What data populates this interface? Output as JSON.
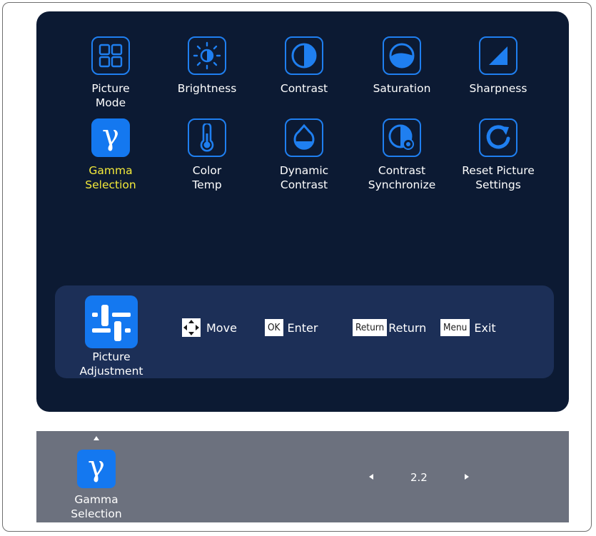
{
  "menu": {
    "items": [
      {
        "id": "picture-mode",
        "label": "Picture\nMode",
        "icon": "grid-icon",
        "active": false
      },
      {
        "id": "brightness",
        "label": "Brightness",
        "icon": "sun-icon",
        "active": false
      },
      {
        "id": "contrast",
        "label": "Contrast",
        "icon": "half-circle-icon",
        "active": false
      },
      {
        "id": "saturation",
        "label": "Saturation",
        "icon": "saturation-icon",
        "active": false
      },
      {
        "id": "sharpness",
        "label": "Sharpness",
        "icon": "triangle-icon",
        "active": false
      },
      {
        "id": "gamma-selection",
        "label": "Gamma\nSelection",
        "icon": "gamma-icon",
        "active": true
      },
      {
        "id": "color-temp",
        "label": "Color\nTemp",
        "icon": "thermometer-icon",
        "active": false
      },
      {
        "id": "dynamic-contrast",
        "label": "Dynamic\nContrast",
        "icon": "drop-icon",
        "active": false
      },
      {
        "id": "contrast-synchronize",
        "label": "Contrast\nSynchronize",
        "icon": "contrast-sync-icon",
        "active": false
      },
      {
        "id": "reset-picture-settings",
        "label": "Reset Picture\nSettings",
        "icon": "reset-icon",
        "active": false
      }
    ]
  },
  "hint_bar": {
    "section_label": "Picture\nAdjustment",
    "section_icon": "sliders-icon",
    "move_label": "Move",
    "ok_key": "OK",
    "enter_label": "Enter",
    "return_key": "Return",
    "return_label": "Return",
    "menu_key": "Menu",
    "exit_label": "Exit"
  },
  "status": {
    "selected_label": "Gamma\nSelection",
    "selected_icon": "gamma-icon",
    "value": "2.2",
    "gamma_symbol": "γ"
  },
  "colors": {
    "osd_background": "#0c1a33",
    "accent_blue": "#1478f0",
    "active_label": "#f4ea3a",
    "status_bar": "#6c717e"
  }
}
